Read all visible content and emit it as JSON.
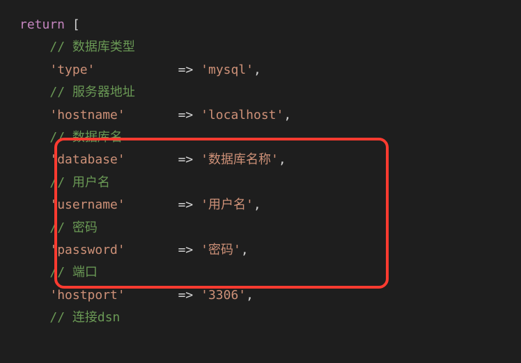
{
  "code": {
    "return_keyword": "return",
    "open_bracket": "[",
    "lines": [
      {
        "comment": "// 数据库类型",
        "key": "'type'",
        "arrow": "=>",
        "value": "'mysql'",
        "comma": ","
      },
      {
        "comment": "// 服务器地址",
        "key": "'hostname'",
        "arrow": "=>",
        "value": "'localhost'",
        "comma": ","
      },
      {
        "comment": "// 数据库名",
        "key": "'database'",
        "arrow": "=>",
        "value": "'数据库名称'",
        "comma": ","
      },
      {
        "comment": "// 用户名",
        "key": "'username'",
        "arrow": "=>",
        "value": "'用户名'",
        "comma": ","
      },
      {
        "comment": "// 密码",
        "key": "'password'",
        "arrow": "=>",
        "value": "'密码'",
        "comma": ","
      },
      {
        "comment": "// 端口",
        "key": "'hostport'",
        "arrow": "=>",
        "value": "'3306'",
        "comma": ","
      },
      {
        "comment": "// 连接dsn",
        "key": "",
        "arrow": "",
        "value": "",
        "comma": ""
      }
    ]
  }
}
